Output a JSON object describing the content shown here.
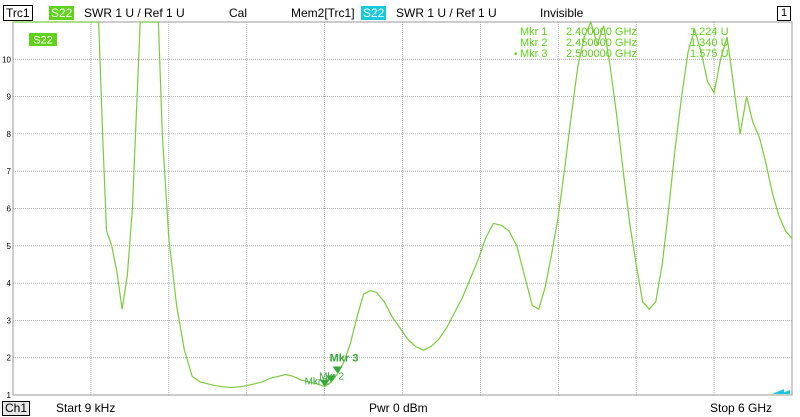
{
  "header": {
    "trace_label": "Trc1",
    "trace_param": "S22",
    "trace_format": "SWR  1 U /  Ref 1 U",
    "cal_label": "Cal",
    "mem_label": "Mem2[Trc1]",
    "mem_param": "S22",
    "mem_format": "SWR  1 U /  Ref 1 U",
    "mem_state": "Invisible",
    "channel_number": "1"
  },
  "trace_tag": "S22",
  "markers": [
    {
      "label": "Mkr 1",
      "freq": "2.400000 GHz",
      "value": "1.224 U",
      "active": false
    },
    {
      "label": "Mkr 2",
      "freq": "2.450000 GHz",
      "value": "1.340 U",
      "active": false
    },
    {
      "label": "Mkr 3",
      "freq": "2.500000 GHz",
      "value": "1.575 U",
      "active": true
    }
  ],
  "plot_markers": {
    "active_label": "Mkr 3",
    "mkr1_label": "Mkr 1",
    "mkr2_label": "Mkr 2"
  },
  "footer": {
    "channel": "Ch1",
    "start": "Start  9 kHz",
    "power": "Pwr  0 dBm",
    "stop": "Stop  6 GHz"
  },
  "colors": {
    "trace": "#7acc3c",
    "grid": "#9a9a9a",
    "marker": "#38a83c",
    "background": "#ffffff"
  },
  "chart_data": {
    "type": "line",
    "xlim": [
      9e-06,
      6.0
    ],
    "ylim": [
      1,
      11
    ],
    "yticks": [
      1,
      2,
      3,
      4,
      5,
      6,
      7,
      8,
      9,
      10
    ],
    "grid": true,
    "series": [
      {
        "x": [
          0.0,
          0.015,
          0.03,
          0.06,
          0.09,
          0.12,
          0.16,
          0.2,
          0.24,
          0.29,
          0.35,
          0.41,
          0.47,
          0.52,
          0.57,
          0.61,
          0.64,
          0.66,
          0.69,
          0.72,
          0.76,
          0.8,
          0.84,
          0.88,
          0.92,
          0.95,
          0.98,
          1.0,
          1.03,
          1.06,
          1.09,
          1.12,
          1.15,
          1.2,
          1.26,
          1.32,
          1.38,
          1.44,
          1.5,
          1.56,
          1.62,
          1.68,
          1.74,
          1.8,
          1.86,
          1.92,
          1.98,
          2.04,
          2.1,
          2.16,
          2.22,
          2.28,
          2.34,
          2.4,
          2.45,
          2.5,
          2.55,
          2.6,
          2.65,
          2.7,
          2.75,
          2.8,
          2.86,
          2.92,
          2.98,
          3.04,
          3.1,
          3.16,
          3.22,
          3.28,
          3.34,
          3.4,
          3.46,
          3.52,
          3.58,
          3.64,
          3.7,
          3.76,
          3.82,
          3.88,
          3.94,
          4.0,
          4.05,
          4.1,
          4.15,
          4.2,
          4.25,
          4.3,
          4.35,
          4.4,
          4.45,
          4.5,
          4.55,
          4.6,
          4.65,
          4.7,
          4.75,
          4.8,
          4.85,
          4.9,
          4.95,
          5.0,
          5.05,
          5.1,
          5.15,
          5.2,
          5.25,
          5.3,
          5.35,
          5.4,
          5.45,
          5.5,
          5.55,
          5.6,
          5.65,
          5.7,
          5.75,
          5.8,
          5.85,
          5.9,
          5.95,
          6.0
        ],
        "y": [
          11.0,
          11.0,
          11.0,
          11.0,
          11.0,
          11.0,
          11.0,
          11.0,
          11.0,
          11.0,
          11.0,
          11.0,
          11.0,
          11.0,
          11.0,
          11.0,
          11.0,
          11.0,
          8.0,
          5.4,
          5.0,
          4.3,
          3.3,
          4.2,
          6.0,
          8.5,
          11.0,
          11.0,
          11.0,
          11.0,
          11.0,
          11.0,
          8.0,
          5.2,
          3.4,
          2.2,
          1.5,
          1.35,
          1.3,
          1.25,
          1.22,
          1.2,
          1.22,
          1.25,
          1.3,
          1.35,
          1.45,
          1.5,
          1.55,
          1.5,
          1.4,
          1.35,
          1.3,
          1.224,
          1.34,
          1.575,
          1.9,
          2.4,
          3.1,
          3.7,
          3.8,
          3.75,
          3.5,
          3.1,
          2.8,
          2.5,
          2.3,
          2.2,
          2.3,
          2.5,
          2.8,
          3.2,
          3.6,
          4.1,
          4.6,
          5.2,
          5.6,
          5.55,
          5.4,
          5.0,
          4.2,
          3.4,
          3.3,
          3.9,
          4.8,
          5.8,
          7.1,
          8.5,
          9.8,
          10.6,
          11.0,
          10.4,
          10.9,
          9.8,
          8.5,
          7.0,
          5.6,
          4.5,
          3.5,
          3.3,
          3.5,
          4.5,
          6.0,
          7.6,
          9.0,
          10.2,
          10.8,
          10.2,
          9.4,
          9.1,
          10.0,
          10.6,
          9.3,
          8.0,
          9.0,
          8.3,
          7.9,
          7.2,
          6.4,
          5.8,
          5.4,
          5.2
        ]
      }
    ]
  }
}
